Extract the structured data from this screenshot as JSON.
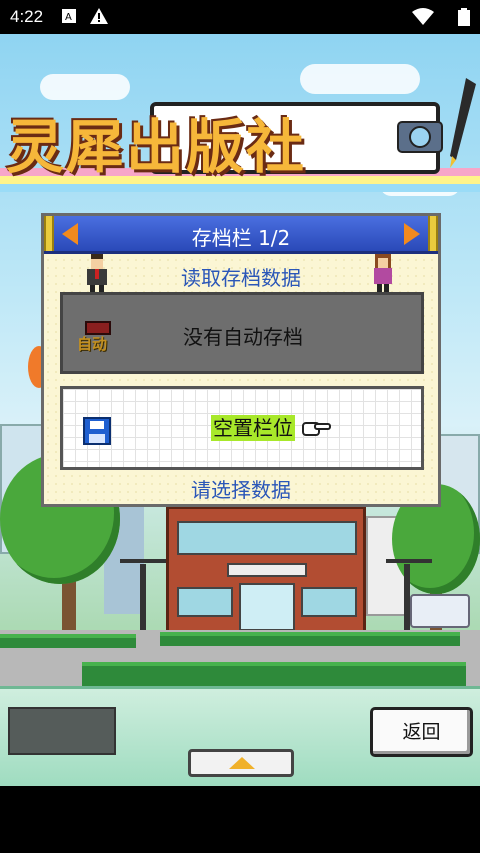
{
  "status_bar": {
    "time": "4:22",
    "icons": [
      "a-notification-icon",
      "warning-icon",
      "wifi-icon",
      "battery-icon"
    ]
  },
  "game": {
    "logo_text": "灵犀出版社"
  },
  "dialog": {
    "title": "存档栏 1/2",
    "subtitle": "读取存档数据",
    "footer": "请选择数据",
    "slots": [
      {
        "badge": "自动",
        "label": "没有自动存档"
      },
      {
        "label": "空置栏位"
      }
    ]
  },
  "bottom_bar": {
    "back_label": "返回"
  },
  "colors": {
    "header_blue": "#3a5ad0",
    "accent_orange": "#f28a1e",
    "highlight_green": "#a8e82a",
    "text_blue": "#2a56b8"
  }
}
